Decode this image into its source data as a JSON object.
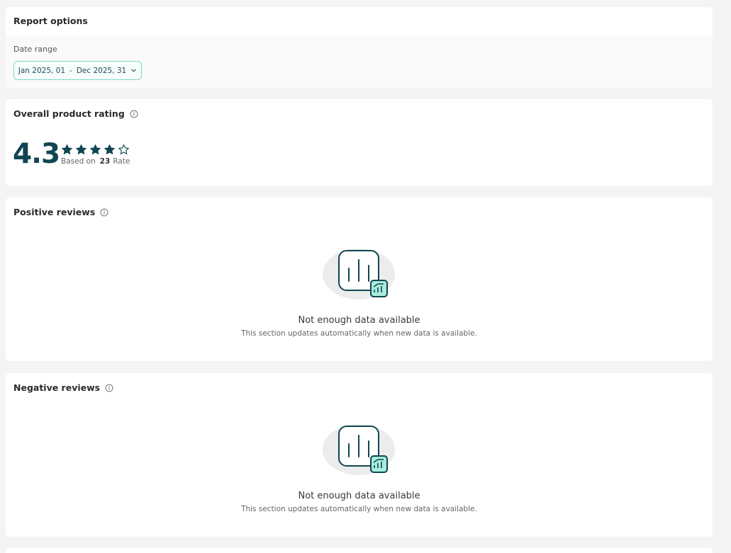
{
  "report_options": {
    "title": "Report options",
    "date_range_label": "Date range",
    "date_start": "Jan 2025, 01",
    "date_sep": "-",
    "date_end": "Dec 2025, 31"
  },
  "overall_rating": {
    "title": "Overall product rating",
    "value": "4.3",
    "stars_filled": 4,
    "stars_total": 5,
    "based_on_label": "Based on",
    "count": "23",
    "count_unit": "Rate"
  },
  "positive_reviews": {
    "title": "Positive reviews",
    "empty_title": "Not enough data available",
    "empty_subtitle": "This section updates automatically when new data is available."
  },
  "negative_reviews": {
    "title": "Negative reviews",
    "empty_title": "Not enough data available",
    "empty_subtitle": "This section updates automatically when new data is available."
  },
  "colors": {
    "accent": "#0f4652",
    "teal_border": "#7fd9c8",
    "teal_fill": "#a9ecdc"
  }
}
